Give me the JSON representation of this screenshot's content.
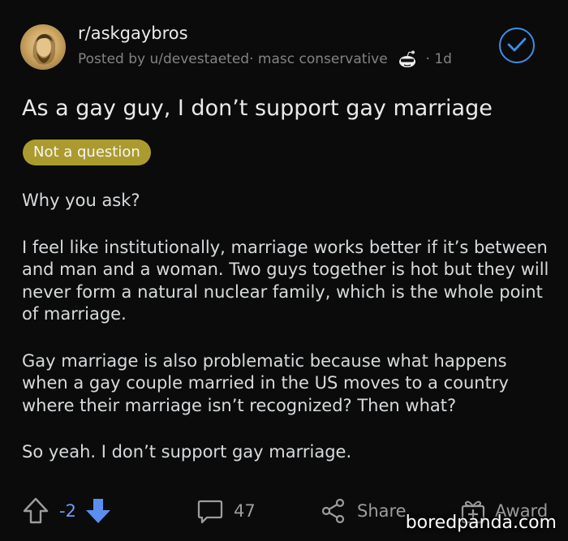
{
  "post": {
    "subreddit": "r/askgaybros",
    "posted_by": "Posted by u/devestaeted",
    "user_flair": "masc conservative",
    "age": "1d",
    "title": "As a gay guy, I don’t support gay marriage",
    "flair": "Not a question",
    "paragraphs": [
      "Why you ask?",
      "I feel like institutionally, marriage works better if it’s between and man and a woman. Two guys together is hot but they will never form a natural nuclear family, which is the whole point of marriage.",
      "Gay marriage is also problematic because what happens when a gay couple married in the US moves to a country where their marriage isn’t recognized? Then what?",
      "So yeah. I don’t support gay marriage."
    ]
  },
  "actions": {
    "score": "-2",
    "comments": "47",
    "share_label": "Share",
    "award_label": "Award"
  },
  "watermark": "boredpanda.com",
  "colors": {
    "background": "#0b0b0b",
    "flair": "#ab9b2f",
    "downvote_active": "#5a8ff0",
    "joined_check": "#3d8fe6"
  }
}
